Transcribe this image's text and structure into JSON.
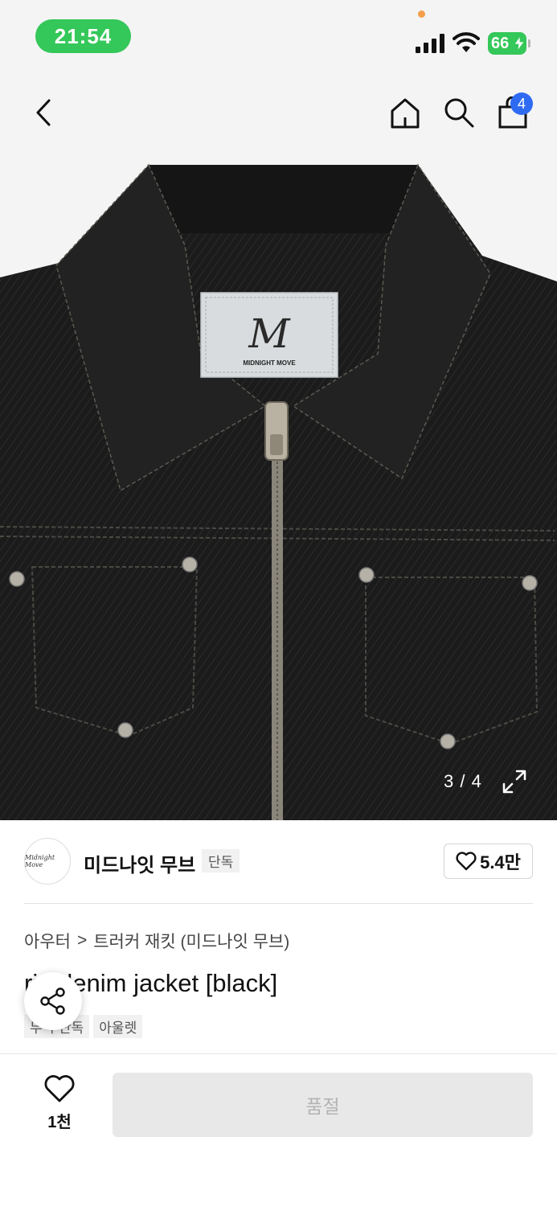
{
  "status_bar": {
    "time": "21:54",
    "battery": "66"
  },
  "nav": {
    "cart_count": "4"
  },
  "product_image": {
    "brand_label_text": "MIDNIGHT MOVE",
    "counter": "3 / 4"
  },
  "brand": {
    "logo_text": "Midnight Move",
    "name": "미드나잇 무브",
    "badge": "단독",
    "likes": "5.4만"
  },
  "breadcrumb": {
    "category": "아우터",
    "separator": ">",
    "subcategory": "트러커 재킷 (미드나잇 무브)"
  },
  "product": {
    "title": "ri    t denim jacket [black]",
    "tags": [
      "무   ㅏ단독",
      "아울렛"
    ]
  },
  "bottom_bar": {
    "wish_count": "1천",
    "buy_button_label": "품절"
  },
  "colors": {
    "status_green": "#34c759",
    "badge_blue": "#2f6bf2",
    "button_disabled": "#e8e8e8"
  }
}
